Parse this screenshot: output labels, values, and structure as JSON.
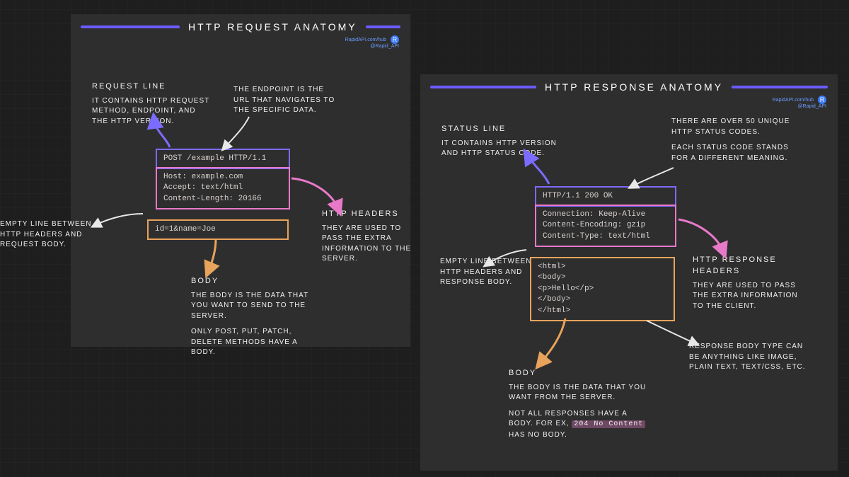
{
  "brand": {
    "line1": "RapidAPI.com/hub",
    "line2": "@Rapid_API",
    "logo": "R"
  },
  "request": {
    "title": "HTTP REQUEST ANATOMY",
    "request_line": {
      "heading": "REQUEST LINE",
      "text": "IT CONTAINS HTTP REQUEST METHOD, ENDPOINT, AND THE HTTP VERSION."
    },
    "endpoint_note": "THE ENDPOINT IS THE URL THAT NAVIGATES TO THE SPECIFIC DATA.",
    "empty_line_note": "EMPTY LINE BETWEEN HTTP HEADERS AND REQUEST BODY.",
    "headers": {
      "heading": "HTTP HEADERS",
      "text": "THEY ARE USED TO PASS THE EXTRA INFORMATION TO THE SERVER."
    },
    "body": {
      "heading": "BODY",
      "text1": "THE BODY IS THE DATA THAT YOU WANT TO SEND TO THE SERVER.",
      "text2": "ONLY POST, PUT, PATCH, DELETE METHODS HAVE A BODY."
    },
    "code": {
      "line": "POST /example HTTP/1.1",
      "h1": "Host: example.com",
      "h2": "Accept: text/html",
      "h3": "Content-Length: 20166",
      "body": "id=1&name=Joe"
    }
  },
  "response": {
    "title": "HTTP RESPONSE ANATOMY",
    "status_line": {
      "heading": "STATUS LINE",
      "text": "IT CONTAINS HTTP VERSION AND HTTP STATUS CODE."
    },
    "codes_note": {
      "text1": "THERE ARE OVER 50 UNIQUE HTTP STATUS CODES.",
      "text2": "EACH STATUS CODE STANDS FOR A DIFFERENT MEANING."
    },
    "empty_line_note": "EMPTY LINE BETWEEN HTTP HEADERS AND RESPONSE BODY.",
    "headers": {
      "heading": "HTTP RESPONSE HEADERS",
      "text": "THEY ARE USED TO PASS THE EXTRA INFORMATION TO THE CLIENT."
    },
    "body_type_note": "RESPONSE BODY TYPE CAN BE ANYTHING LIKE IMAGE, PLAIN TEXT, TEXT/CSS, ETC.",
    "body": {
      "heading": "BODY",
      "text1": "THE BODY IS THE DATA THAT YOU WANT FROM THE SERVER.",
      "text2a": "NOT ALL RESPONSES HAVE A BODY. FOR EX, ",
      "highlight": "204 No Content",
      "text2b": " HAS NO BODY."
    },
    "code": {
      "line": "HTTP/1.1 200 OK",
      "h1": "Connection: Keep-Alive",
      "h2": "Content-Encoding: gzip",
      "h3": "Content-Type: text/html",
      "b1": "<html>",
      "b2": "<body>",
      "b3": "<p>Hello</p>",
      "b4": "</body>",
      "b5": "</html>"
    }
  }
}
